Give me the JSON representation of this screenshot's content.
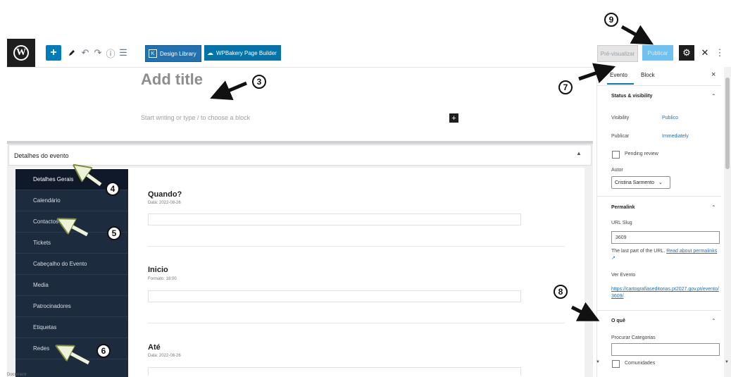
{
  "toolbar": {
    "add_block_symbol": "+",
    "design_library_label": "Design Library",
    "design_library_icon": "K",
    "wpbakery_label": "WPBakery Page Builder",
    "preview_label": "Pré-visualizar",
    "publish_label": "Publicar"
  },
  "editor": {
    "title_placeholder": "Add title",
    "paragraph_placeholder": "Start writing or type / to choose a block",
    "inline_add_symbol": "+"
  },
  "event_box": {
    "title": "Detalhes do evento",
    "nav_items": [
      {
        "label": "Detalhes Gerais",
        "active": true
      },
      {
        "label": "Calendário",
        "active": false
      },
      {
        "label": "Contactos",
        "active": false
      },
      {
        "label": "Tickets",
        "active": false
      },
      {
        "label": "Cabeçalho do Evento",
        "active": false
      },
      {
        "label": "Media",
        "active": false
      },
      {
        "label": "Patrocinadores",
        "active": false
      },
      {
        "label": "Etiquetas",
        "active": false
      },
      {
        "label": "Redes",
        "active": false
      }
    ],
    "fields": [
      {
        "label": "Quando?",
        "sub": "Data: 2022-08-26"
      },
      {
        "label": "Inicio",
        "sub": "Formato: 18:00"
      },
      {
        "label": "Até",
        "sub": "Data: 2022-08-26"
      }
    ]
  },
  "sidebar": {
    "tab_event": "Evento",
    "tab_block": "Block",
    "close_symbol": "×",
    "status": {
      "title": "Status & visibility",
      "visibility_label": "Visibility",
      "visibility_value": "Publico",
      "publish_label": "Publicar",
      "publish_value": "Immediately",
      "pending_label": "Pending review",
      "author_label": "Autor",
      "author_value": "Cristina Sarmento"
    },
    "permalink": {
      "title": "Permalink",
      "slug_label": "URL Slug",
      "slug_value": "3609",
      "help_text": "The last part of the URL.",
      "help_link": "Read about permalinks",
      "view_label": "Ver Evento",
      "view_url": "https://cartografiaseditorias.pt2027.gov.pt/evento/3609/"
    },
    "what": {
      "title": "O quê",
      "search_label": "Procurar Categorias",
      "first_category": "Comunidades"
    }
  },
  "annotations": [
    "3",
    "4",
    "5",
    "6",
    "7",
    "8",
    "9"
  ],
  "footer_label": "Document",
  "colors": {
    "primary": "#007cba",
    "nav_bg": "#1d2b3e",
    "link": "#2271b1"
  }
}
